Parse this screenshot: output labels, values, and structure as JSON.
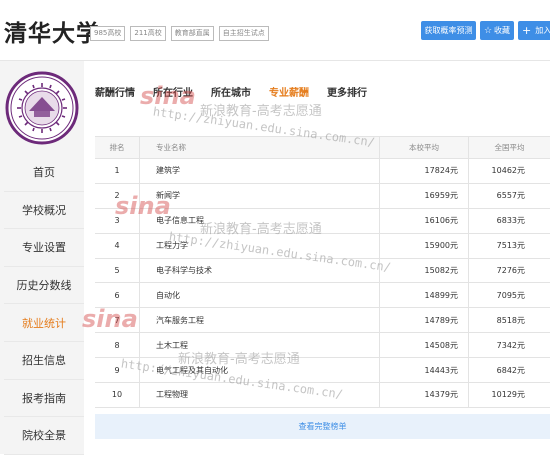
{
  "header": {
    "title": "清华大学",
    "tags": [
      "985高校",
      "211高校",
      "教育部直属",
      "自主招生试点"
    ],
    "buttons": {
      "predict": "获取概率预测",
      "collect": "收藏",
      "join": "加入"
    }
  },
  "sidebar": {
    "logo_icon": "tsinghua-seal-icon",
    "items": [
      {
        "label": "首页",
        "active": false
      },
      {
        "label": "学校概况",
        "active": false
      },
      {
        "label": "专业设置",
        "active": false
      },
      {
        "label": "历史分数线",
        "active": false
      },
      {
        "label": "就业统计",
        "active": true
      },
      {
        "label": "招生信息",
        "active": false
      },
      {
        "label": "报考指南",
        "active": false
      },
      {
        "label": "院校全景",
        "active": false
      }
    ]
  },
  "tabs": [
    {
      "label": "薪酬行情",
      "active": false
    },
    {
      "label": "所在行业",
      "active": false
    },
    {
      "label": "所在城市",
      "active": false
    },
    {
      "label": "专业薪酬",
      "active": true
    },
    {
      "label": "更多排行",
      "active": false
    }
  ],
  "table": {
    "headers": {
      "rank": "排名",
      "name": "专业名称",
      "school_avg": "本校平均",
      "national_avg": "全国平均"
    },
    "rows": [
      {
        "rank": "1",
        "name": "建筑学",
        "school_avg": "17824元",
        "national_avg": "10462元"
      },
      {
        "rank": "2",
        "name": "新闻学",
        "school_avg": "16959元",
        "national_avg": "6557元"
      },
      {
        "rank": "3",
        "name": "电子信息工程",
        "school_avg": "16106元",
        "national_avg": "6833元"
      },
      {
        "rank": "4",
        "name": "工程力学",
        "school_avg": "15900元",
        "national_avg": "7513元"
      },
      {
        "rank": "5",
        "name": "电子科学与技术",
        "school_avg": "15082元",
        "national_avg": "7276元"
      },
      {
        "rank": "6",
        "name": "自动化",
        "school_avg": "14899元",
        "national_avg": "7095元"
      },
      {
        "rank": "7",
        "name": "汽车服务工程",
        "school_avg": "14789元",
        "national_avg": "8518元"
      },
      {
        "rank": "8",
        "name": "土木工程",
        "school_avg": "14508元",
        "national_avg": "7342元"
      },
      {
        "rank": "9",
        "name": "电气工程及其自动化",
        "school_avg": "14443元",
        "national_avg": "6842元"
      },
      {
        "rank": "10",
        "name": "工程物理",
        "school_avg": "14379元",
        "national_avg": "10129元"
      }
    ],
    "more_label": "查看完整榜单"
  },
  "watermark": {
    "brand": "sina",
    "text": "新浪教育-高考志愿通",
    "url": "http://zhiyuan.edu.sina.com.cn/"
  },
  "colors": {
    "accent": "#3e8ee6",
    "active": "#e57c1b",
    "seal": "#6d2a7a"
  }
}
